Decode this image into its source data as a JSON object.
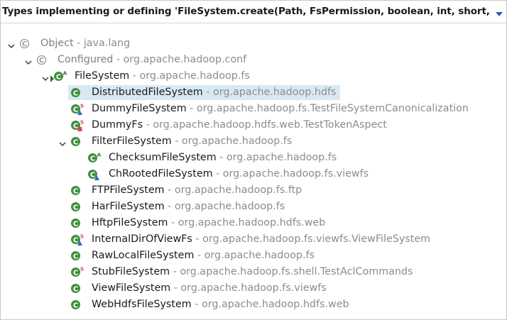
{
  "header": {
    "title": "Types implementing or defining 'FileSystem.create(Path, FsPermission, boolean, int, short, lo"
  },
  "colors": {
    "class_icon_fill": "#3f8f3f",
    "class_icon_dim": "#9a9a9a",
    "abstract_badge": "#2f6f2f",
    "static_badge": "#d04a4a",
    "triangle_badge": "#2f64c8",
    "square_badge": "#d04a4a",
    "selection": "#d8e9f4"
  },
  "tree": {
    "separator": " - ",
    "rows": [
      {
        "name": "Object",
        "pkg": "java.lang",
        "depth": 0,
        "expanded": true,
        "icon": "class-icon-dim",
        "dim": true
      },
      {
        "name": "Configured",
        "pkg": "org.apache.hadoop.conf",
        "depth": 1,
        "expanded": true,
        "icon": "class-icon-dim",
        "dim": true
      },
      {
        "name": "FileSystem",
        "pkg": "org.apache.hadoop.fs",
        "depth": 2,
        "expanded": true,
        "icon": "abstract-class-icon",
        "focus": true
      },
      {
        "name": "DistributedFileSystem",
        "pkg": "org.apache.hadoop.hdfs",
        "depth": 3,
        "icon": "class-icon",
        "selected": true
      },
      {
        "name": "DummyFileSystem",
        "pkg": "org.apache.hadoop.fs.TestFileSystemCanonicalization",
        "depth": 3,
        "icon": "static-nested-class-icon"
      },
      {
        "name": "DummyFs",
        "pkg": "org.apache.hadoop.hdfs.web.TestTokenAspect",
        "depth": 3,
        "icon": "static-private-class-icon"
      },
      {
        "name": "FilterFileSystem",
        "pkg": "org.apache.hadoop.fs",
        "depth": 3,
        "expanded": true,
        "icon": "class-icon"
      },
      {
        "name": "ChecksumFileSystem",
        "pkg": "org.apache.hadoop.fs",
        "depth": 4,
        "icon": "abstract-class-icon"
      },
      {
        "name": "ChRootedFileSystem",
        "pkg": "org.apache.hadoop.fs.viewfs",
        "depth": 4,
        "icon": "package-class-icon"
      },
      {
        "name": "FTPFileSystem",
        "pkg": "org.apache.hadoop.fs.ftp",
        "depth": 3,
        "icon": "class-icon"
      },
      {
        "name": "HarFileSystem",
        "pkg": "org.apache.hadoop.fs",
        "depth": 3,
        "icon": "class-icon"
      },
      {
        "name": "HftpFileSystem",
        "pkg": "org.apache.hadoop.hdfs.web",
        "depth": 3,
        "icon": "class-icon"
      },
      {
        "name": "InternalDirOfViewFs",
        "pkg": "org.apache.hadoop.fs.viewfs.ViewFileSystem",
        "depth": 3,
        "icon": "static-nested-class-icon"
      },
      {
        "name": "RawLocalFileSystem",
        "pkg": "org.apache.hadoop.fs",
        "depth": 3,
        "icon": "class-icon"
      },
      {
        "name": "StubFileSystem",
        "pkg": "org.apache.hadoop.fs.shell.TestAclCommands",
        "depth": 3,
        "icon": "static-class-icon"
      },
      {
        "name": "ViewFileSystem",
        "pkg": "org.apache.hadoop.fs.viewfs",
        "depth": 3,
        "icon": "class-icon"
      },
      {
        "name": "WebHdfsFileSystem",
        "pkg": "org.apache.hadoop.hdfs.web",
        "depth": 3,
        "icon": "class-icon"
      }
    ]
  }
}
